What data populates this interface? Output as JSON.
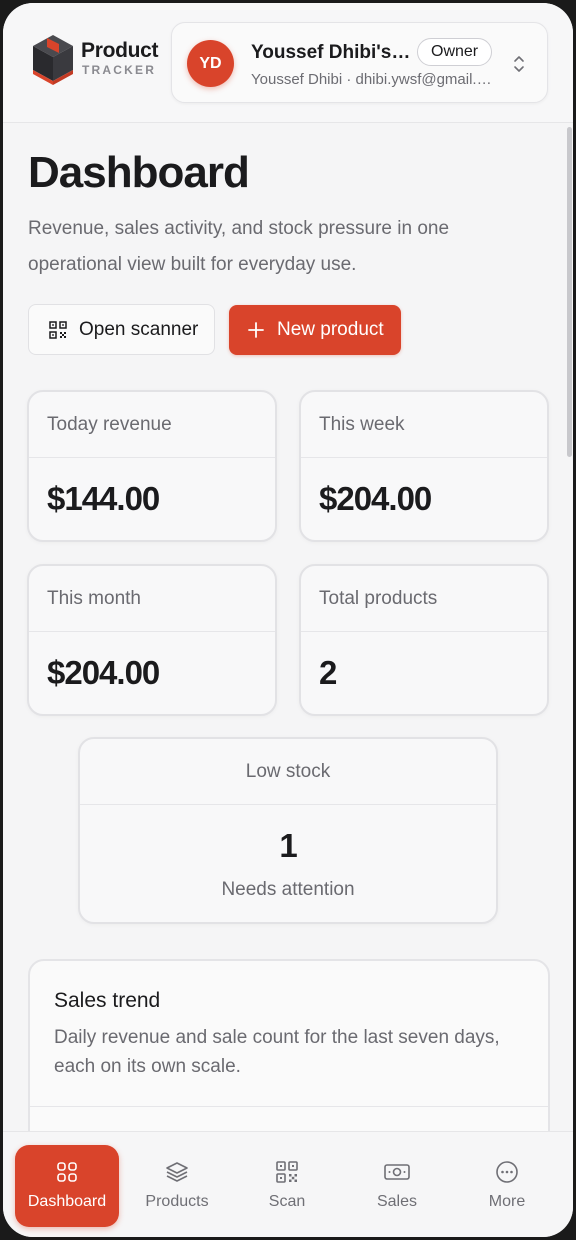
{
  "brand": {
    "name_line1": "Product",
    "name_line2": "TRACKER"
  },
  "account": {
    "initials": "YD",
    "name": "Youssef Dhibi's Workspace",
    "role": "Owner",
    "subtitle": "Youssef Dhibi · dhibi.ywsf@gmail.com"
  },
  "page": {
    "title": "Dashboard",
    "subtitle": "Revenue, sales activity, and stock pressure in one operational view built for everyday use."
  },
  "actions": {
    "scanner_label": "Open scanner",
    "new_product_label": "New product"
  },
  "stats": [
    {
      "label": "Today revenue",
      "value": "$144.00"
    },
    {
      "label": "This week",
      "value": "$204.00"
    },
    {
      "label": "This month",
      "value": "$204.00"
    },
    {
      "label": "Total products",
      "value": "2"
    }
  ],
  "low_stock": {
    "label": "Low stock",
    "value": "1",
    "note": "Needs attention"
  },
  "sales_trend": {
    "title": "Sales trend",
    "description": "Daily revenue and sale count for the last seven days, each on its own scale."
  },
  "nav": [
    {
      "label": "Dashboard",
      "icon": "grid-icon",
      "active": true
    },
    {
      "label": "Products",
      "icon": "layers-icon",
      "active": false
    },
    {
      "label": "Scan",
      "icon": "qr-code-icon",
      "active": false
    },
    {
      "label": "Sales",
      "icon": "banknote-icon",
      "active": false
    },
    {
      "label": "More",
      "icon": "more-circle-icon",
      "active": false
    }
  ],
  "colors": {
    "accent": "#d9442b",
    "background": "#f5f5f6",
    "text": "#1b1b1d",
    "muted": "#6a6a70"
  }
}
